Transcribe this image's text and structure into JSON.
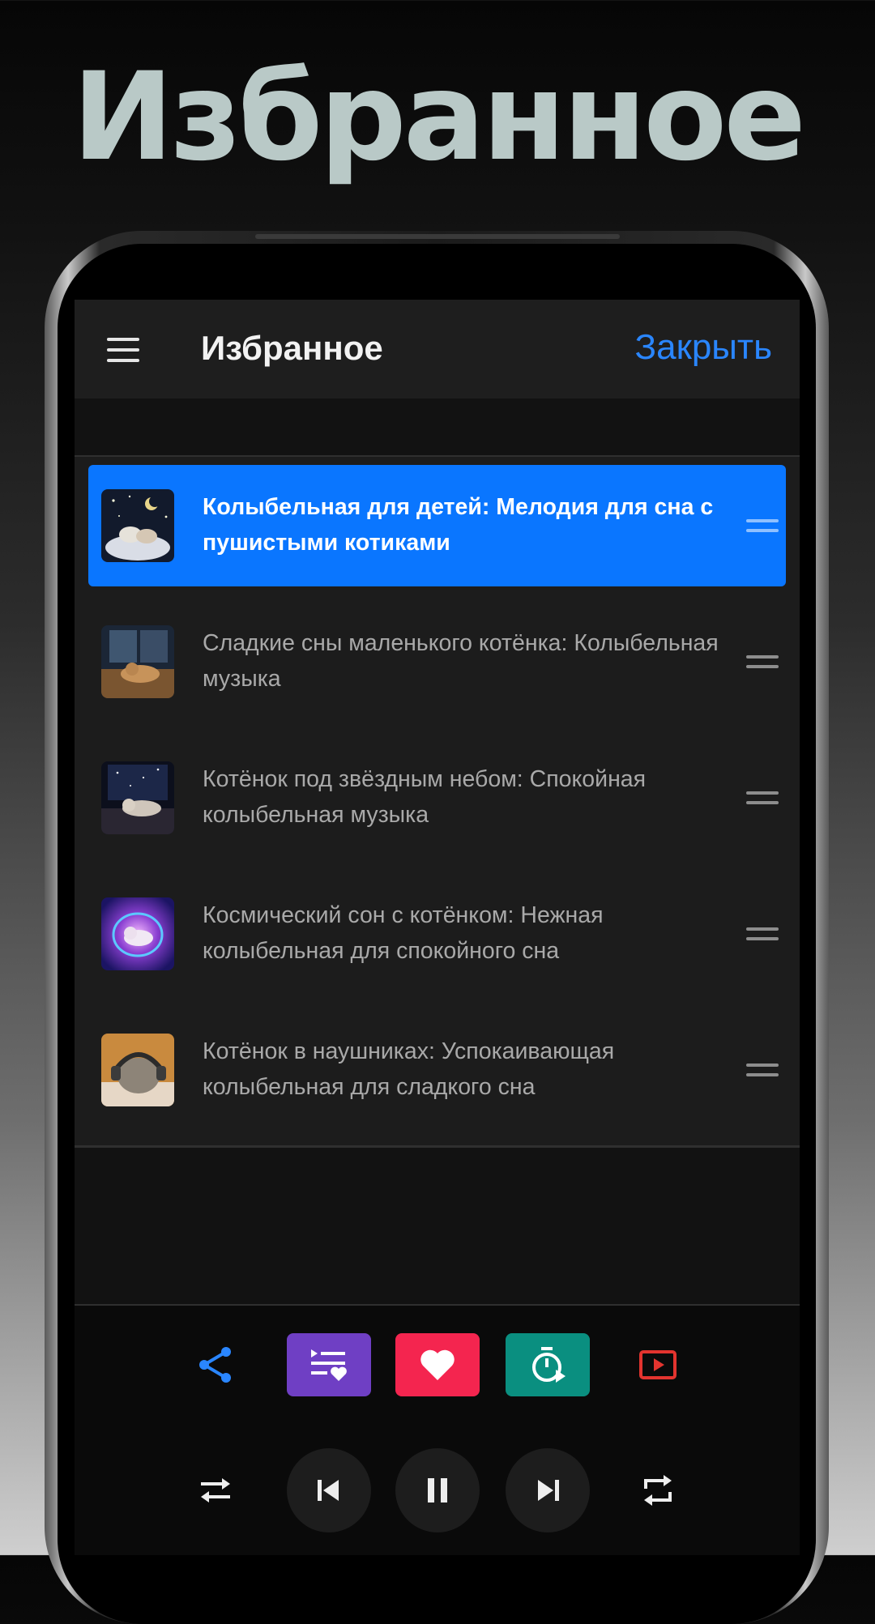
{
  "promo": {
    "title": "Избранное"
  },
  "header": {
    "title": "Избранное",
    "close_label": "Закрыть",
    "menu_icon": "hamburger-menu-icon"
  },
  "tracks": [
    {
      "title": "Колыбельная для детей: Мелодия для сна с пушистыми котиками",
      "thumb": "kittens-on-cloud-night-sky",
      "active": true
    },
    {
      "title": "Сладкие сны маленького котёнка: Колыбельная музыка",
      "thumb": "kitten-sleeping-by-window",
      "active": false
    },
    {
      "title": "Котёнок под звёздным небом: Спокойная колыбельная музыка",
      "thumb": "kitten-under-starry-sky",
      "active": false
    },
    {
      "title": "Космический сон с котёнком: Нежная колыбельная для спокойного сна",
      "thumb": "kitten-in-cosmic-nebula",
      "active": false
    },
    {
      "title": "Котёнок в наушниках: Успокаивающая колыбельная для сладкого сна",
      "thumb": "kitten-with-headphones",
      "active": false
    }
  ],
  "actions": [
    {
      "name": "share",
      "icon": "share-icon",
      "color": "#2a86ff"
    },
    {
      "name": "playlist-favorites",
      "icon": "playlist-heart-icon",
      "color": "#6f3fc4"
    },
    {
      "name": "favorite",
      "icon": "heart-icon",
      "color": "#f4254f"
    },
    {
      "name": "sleep-timer",
      "icon": "timer-icon",
      "color": "#0a8f80"
    },
    {
      "name": "video",
      "icon": "play-video-icon",
      "color": "#e3342f"
    }
  ],
  "controls": [
    "shuffle-icon",
    "previous-icon",
    "pause-icon",
    "next-icon",
    "repeat-icon"
  ],
  "colors": {
    "accent": "#0a76ff",
    "link": "#2a86ff",
    "promo_title": "#b9c9c7"
  }
}
